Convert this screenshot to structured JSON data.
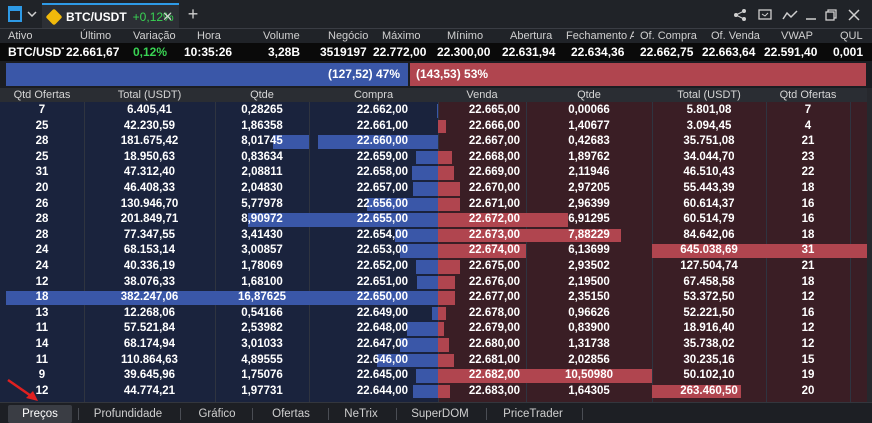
{
  "topbar": {
    "symbol": "BTC/USDT",
    "change": "+0,12%",
    "add_symbol": "+",
    "window_controls": [
      "share-icon",
      "screen-icon",
      "chart-trend-icon",
      "minimize-icon",
      "restore-icon",
      "close-icon"
    ]
  },
  "quote_columns": [
    "Ativo",
    "Último",
    "Variação",
    "Hora",
    "Volume",
    "Negócio",
    "Máximo",
    "Mínimo",
    "Abertura",
    "Fechamento A",
    "Of. Compra",
    "Of. Venda",
    "VWAP",
    "QUL"
  ],
  "quote_values": [
    "BTC/USDT",
    "22.661,67",
    "0,12%",
    "10:35:26",
    "3,28B",
    "3519197",
    "22.772,00",
    "22.300,00",
    "22.631,94",
    "22.634,36",
    "22.662,75",
    "22.663,64",
    "22.591,40",
    "0,001"
  ],
  "balance": {
    "bid_text": "(127,52) 47%",
    "ask_text": "(143,53) 53%",
    "bid_pct": 47,
    "ask_pct": 53
  },
  "book_columns": [
    "Qtd Ofertas",
    "Total (USDT)",
    "Qtde",
    "Compra",
    "Venda",
    "Qtde",
    "Total (USDT)",
    "Qtd Ofertas"
  ],
  "book_rows": [
    {
      "bo": "7",
      "bt": "6.405,41",
      "bq": "0,28265",
      "bp": "22.662,00",
      "ap": "22.665,00",
      "aq": "0,00066",
      "at": "5.801,08",
      "ao": "7",
      "bpb": 0.01,
      "apb": 0,
      "aqb": 0,
      "atb": 0
    },
    {
      "bo": "25",
      "bt": "42.230,59",
      "bq": "1,86358",
      "bp": "22.661,00",
      "ap": "22.666,00",
      "aq": "1,40677",
      "at": "3.094,45",
      "ao": "4",
      "bpb": 0,
      "apb": 0.05,
      "aqb": 0,
      "atb": 0
    },
    {
      "bo": "28",
      "bt": "181.675,42",
      "bq": "8,01745",
      "bp": "22.660,00",
      "ap": "22.667,00",
      "aq": "0,42683",
      "at": "35.751,08",
      "ao": "21",
      "bpb": 0.92,
      "bqb": 0.38,
      "apb": 0,
      "aqb": 0,
      "atb": 0
    },
    {
      "bo": "25",
      "bt": "18.950,63",
      "bq": "0,83634",
      "bp": "22.659,00",
      "ap": "22.668,00",
      "aq": "1,89762",
      "at": "34.044,70",
      "ao": "23",
      "bpb": 0.17,
      "apb": 0.09,
      "aqb": 0,
      "atb": 0
    },
    {
      "bo": "31",
      "bt": "47.312,40",
      "bq": "2,08811",
      "bp": "22.658,00",
      "ap": "22.669,00",
      "aq": "2,11946",
      "at": "46.510,43",
      "ao": "22",
      "bpb": 0.2,
      "apb": 0.1,
      "aqb": 0,
      "atb": 0
    },
    {
      "bo": "20",
      "bt": "46.408,33",
      "bq": "2,04830",
      "bp": "22.657,00",
      "ap": "22.670,00",
      "aq": "2,97205",
      "at": "55.443,39",
      "ao": "18",
      "bpb": 0.19,
      "apb": 0.14,
      "aqb": 0,
      "atb": 0
    },
    {
      "bo": "26",
      "bt": "130.946,70",
      "bq": "5,77978",
      "bp": "22.656,00",
      "ap": "22.671,00",
      "aq": "2,96399",
      "at": "60.614,37",
      "ao": "16",
      "bpb": 0.55,
      "apb": 0.14,
      "aqb": 0,
      "atb": 0
    },
    {
      "bo": "28",
      "bt": "201.849,71",
      "bq": "8,90972",
      "bp": "22.655,00",
      "ap": "22.672,00",
      "aq": "6,91295",
      "at": "60.514,79",
      "ao": "16",
      "bpb": 1,
      "bqb": 0.65,
      "apb": 1,
      "aqb": 0.33,
      "atb": 0
    },
    {
      "bo": "28",
      "bt": "77.347,55",
      "bq": "3,41430",
      "bp": "22.654,00",
      "ap": "22.673,00",
      "aq": "7,88229",
      "at": "84.642,06",
      "ao": "18",
      "bpb": 0.33,
      "apb": 1,
      "aqb": 0.75,
      "atb": 0
    },
    {
      "bo": "24",
      "bt": "68.153,14",
      "bq": "3,00857",
      "bp": "22.653,00",
      "ap": "22.674,00",
      "aq": "6,13699",
      "at": "645.038,69",
      "ao": "31",
      "bpb": 0.29,
      "apb": 1,
      "aqb": 0,
      "atb": 1
    },
    {
      "bo": "24",
      "bt": "40.336,19",
      "bq": "1,78069",
      "bp": "22.652,00",
      "ap": "22.675,00",
      "aq": "2,93502",
      "at": "127.504,74",
      "ao": "21",
      "bpb": 0.17,
      "apb": 0.14,
      "aqb": 0,
      "atb": 0
    },
    {
      "bo": "12",
      "bt": "38.076,33",
      "bq": "1,68100",
      "bp": "22.651,00",
      "ap": "22.676,00",
      "aq": "2,19500",
      "at": "67.458,58",
      "ao": "18",
      "bpb": 0.16,
      "apb": 0.11,
      "aqb": 0,
      "atb": 0
    },
    {
      "bo": "18",
      "bt": "382.247,06",
      "bq": "16,87625",
      "bp": "22.650,00",
      "ap": "22.677,00",
      "aq": "2,35150",
      "at": "53.372,50",
      "ao": "12",
      "bpb": 1,
      "bqb": 1,
      "btb": 1,
      "bob": 1,
      "apb": 0.11,
      "aqb": 0,
      "atb": 0
    },
    {
      "bo": "13",
      "bt": "12.268,06",
      "bq": "0,54166",
      "bp": "22.649,00",
      "ap": "22.678,00",
      "aq": "0,96626",
      "at": "52.221,50",
      "ao": "16",
      "bpb": 0.05,
      "apb": 0.05,
      "aqb": 0,
      "atb": 0
    },
    {
      "bo": "11",
      "bt": "57.521,84",
      "bq": "2,53982",
      "bp": "22.648,00",
      "ap": "22.679,00",
      "aq": "0,83900",
      "at": "18.916,40",
      "ao": "12",
      "bpb": 0.24,
      "apb": 0.04,
      "aqb": 0,
      "atb": 0
    },
    {
      "bo": "14",
      "bt": "68.174,94",
      "bq": "3,01033",
      "bp": "22.647,00",
      "ap": "22.680,00",
      "aq": "1,31738",
      "at": "35.738,02",
      "ao": "12",
      "bpb": 0.29,
      "apb": 0.07,
      "aqb": 0,
      "atb": 0
    },
    {
      "bo": "11",
      "bt": "110.864,63",
      "bq": "4,89555",
      "bp": "22.646,00",
      "ap": "22.681,00",
      "aq": "2,02856",
      "at": "30.235,16",
      "ao": "15",
      "bpb": 0.47,
      "apb": 0.1,
      "aqb": 0,
      "atb": 0
    },
    {
      "bo": "9",
      "bt": "39.645,96",
      "bq": "1,75076",
      "bp": "22.645,00",
      "ap": "22.682,00",
      "aq": "10,50980",
      "at": "50.102,10",
      "ao": "19",
      "bpb": 0.17,
      "apb": 1,
      "aqb": 1,
      "atb": 0
    },
    {
      "bo": "12",
      "bt": "44.774,21",
      "bq": "1,97731",
      "bp": "22.644,00",
      "ap": "22.683,00",
      "aq": "1,64305",
      "at": "263.460,50",
      "ao": "20",
      "bpb": 0.19,
      "apb": 0.08,
      "aqb": 0,
      "atb": 0.41
    }
  ],
  "tabs": [
    "Preços",
    "Profundidade",
    "Gráfico",
    "Ofertas",
    "NeTrix",
    "SuperDOM",
    "PriceTrader"
  ],
  "active_tab": "Preços",
  "colors": {
    "bid_bar": "#3a57a8",
    "ask_bar": "#b0454f",
    "bid_bg": "#1a233d",
    "ask_bg": "#3a1e25",
    "positive": "#39d353",
    "accent": "#2e9ae6"
  }
}
